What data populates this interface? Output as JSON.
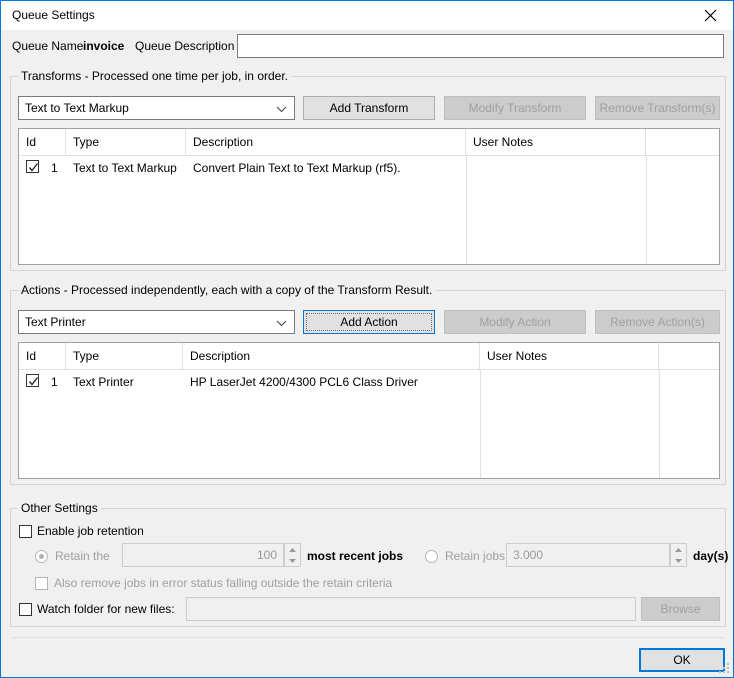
{
  "window": {
    "title": "Queue Settings",
    "close_icon": "close-icon",
    "accent_color": "#0078d7"
  },
  "queue": {
    "name_label": "Queue Name",
    "name_value": "invoice",
    "description_label": "Queue Description",
    "description_value": "",
    "description_placeholder": ""
  },
  "transforms": {
    "legend": "Transforms - Processed one time per job, in order.",
    "combo_value": "Text to Text Markup",
    "combo_arrow_icon": "chevron-down-icon",
    "buttons": {
      "add": "Add Transform",
      "modify": "Modify Transform",
      "remove": "Remove Transform(s)"
    },
    "columns": [
      "Id",
      "Type",
      "Description",
      "User Notes",
      ""
    ],
    "rows": [
      {
        "checked": true,
        "id": "1",
        "type": "Text to Text Markup",
        "description": "Convert Plain Text to Text Markup (rf5).",
        "user_notes": ""
      }
    ]
  },
  "actions": {
    "legend": "Actions - Processed independently, each with a copy of the Transform Result.",
    "combo_value": "Text Printer",
    "combo_arrow_icon": "chevron-down-icon",
    "buttons": {
      "add": "Add Action",
      "modify": "Modify Action",
      "remove": "Remove Action(s)"
    },
    "columns": [
      "Id",
      "Type",
      "Description",
      "User Notes",
      ""
    ],
    "rows": [
      {
        "checked": true,
        "id": "1",
        "type": "Text Printer",
        "description": "HP LaserJet 4200/4300 PCL6 Class Driver",
        "user_notes": ""
      }
    ]
  },
  "other_settings": {
    "legend": "Other Settings",
    "enable_job_retention": "Enable job retention",
    "retain_the": "Retain the",
    "retain_count_value": "100",
    "most_recent_jobs": "most recent jobs",
    "retain_jobs_for": "Retain jobs for",
    "retain_days_value": "3.000",
    "days_label": "day(s)",
    "also_remove": "Also remove jobs in error status falling outside the retain criteria",
    "watch_folder": "Watch folder for new files:",
    "watch_folder_value": "",
    "browse": "Browse"
  },
  "footer": {
    "ok": "OK"
  }
}
